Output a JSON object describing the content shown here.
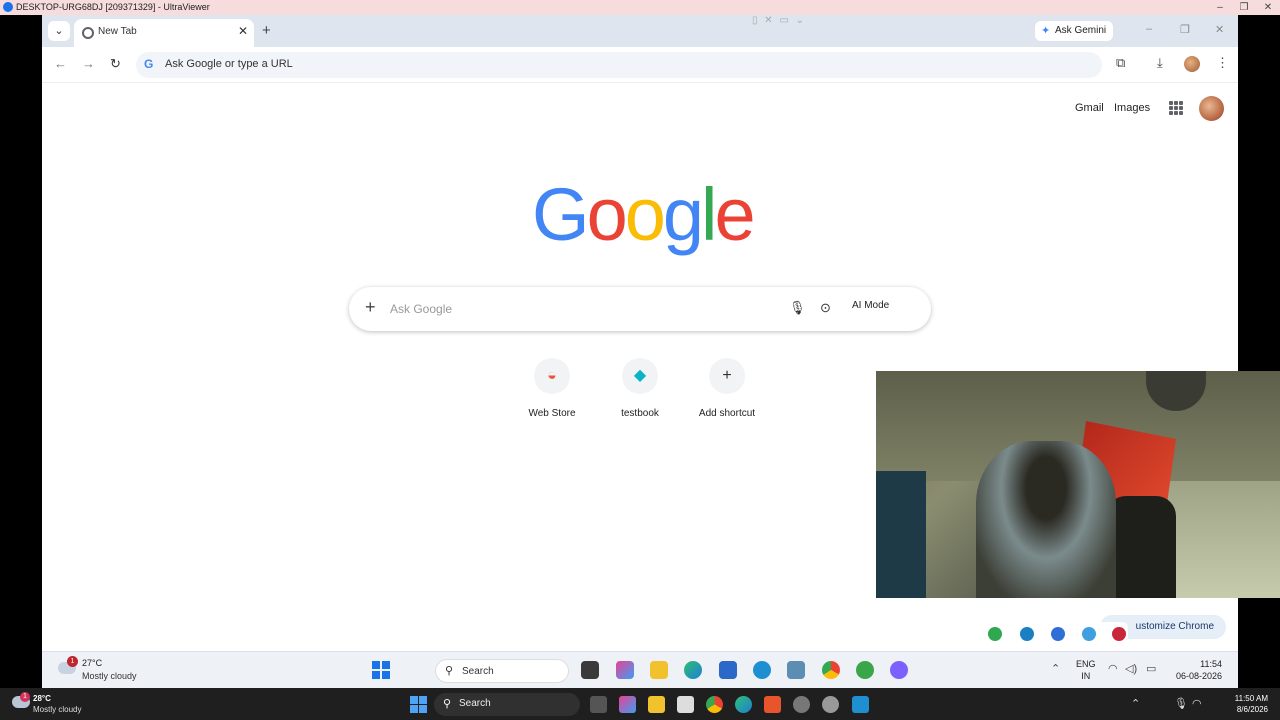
{
  "uv": {
    "title": "DESKTOP-URG68DJ [209371329] - UltraViewer",
    "controls": [
      "–",
      "❐",
      "✕"
    ]
  },
  "chrome": {
    "tab_dropdown": "⌄",
    "tab_title": "New Tab",
    "tab_close": "✕",
    "new_tab": "+",
    "ghost_controls": "▯ ✕ ▭ ⌄",
    "gemini_label": "Ask Gemini",
    "gemini_icon": "✦",
    "window_controls": [
      "–",
      "❐",
      "✕"
    ],
    "back": "←",
    "forward": "→",
    "reload": "↻",
    "omnibox_g": "G",
    "omnibox_placeholder": "Ask Google or type a URL",
    "extensions_icon": "⧉",
    "download_icon": "⤓",
    "menu_icon": "⋮"
  },
  "ntp": {
    "gmail": "Gmail",
    "images": "Images",
    "logo_letters": [
      "G",
      "o",
      "o",
      "g",
      "l",
      "e"
    ],
    "logo_colors": [
      "#4285f4",
      "#ea4335",
      "#fbbc05",
      "#4285f4",
      "#34a853",
      "#ea4335"
    ],
    "search_plus": "+",
    "search_placeholder": "Ask Google",
    "mic_icon": "🎙",
    "lens_icon": "⊙",
    "ai_mode": "AI Mode",
    "shortcuts": [
      {
        "label": "Web Store",
        "icon": "◒"
      },
      {
        "label": "testbook",
        "icon": "◆"
      },
      {
        "label": "Add shortcut",
        "icon": "+"
      }
    ],
    "customize_label": "ustomize Chrome"
  },
  "remote_taskbar": {
    "badge": "1",
    "temp": "27°C",
    "condition": "Mostly cloudy",
    "search_icon": "⚲",
    "search_label": "Search",
    "lang_top": "ENG",
    "lang_bottom": "IN",
    "time": "11:54",
    "date": "06-08-2026",
    "chevron": "⌃",
    "wifi": "◠",
    "volume": "◁)",
    "battery": "▭"
  },
  "local_taskbar": {
    "badge": "1",
    "temp": "28°C",
    "condition": "Mostly cloudy",
    "search_icon": "⚲",
    "search_label": "Search",
    "time": "11:50 AM",
    "date": "8/6/2026",
    "chevron": "⌃",
    "mic": "🎙",
    "wifi": "◠",
    "volume": "◁)"
  }
}
